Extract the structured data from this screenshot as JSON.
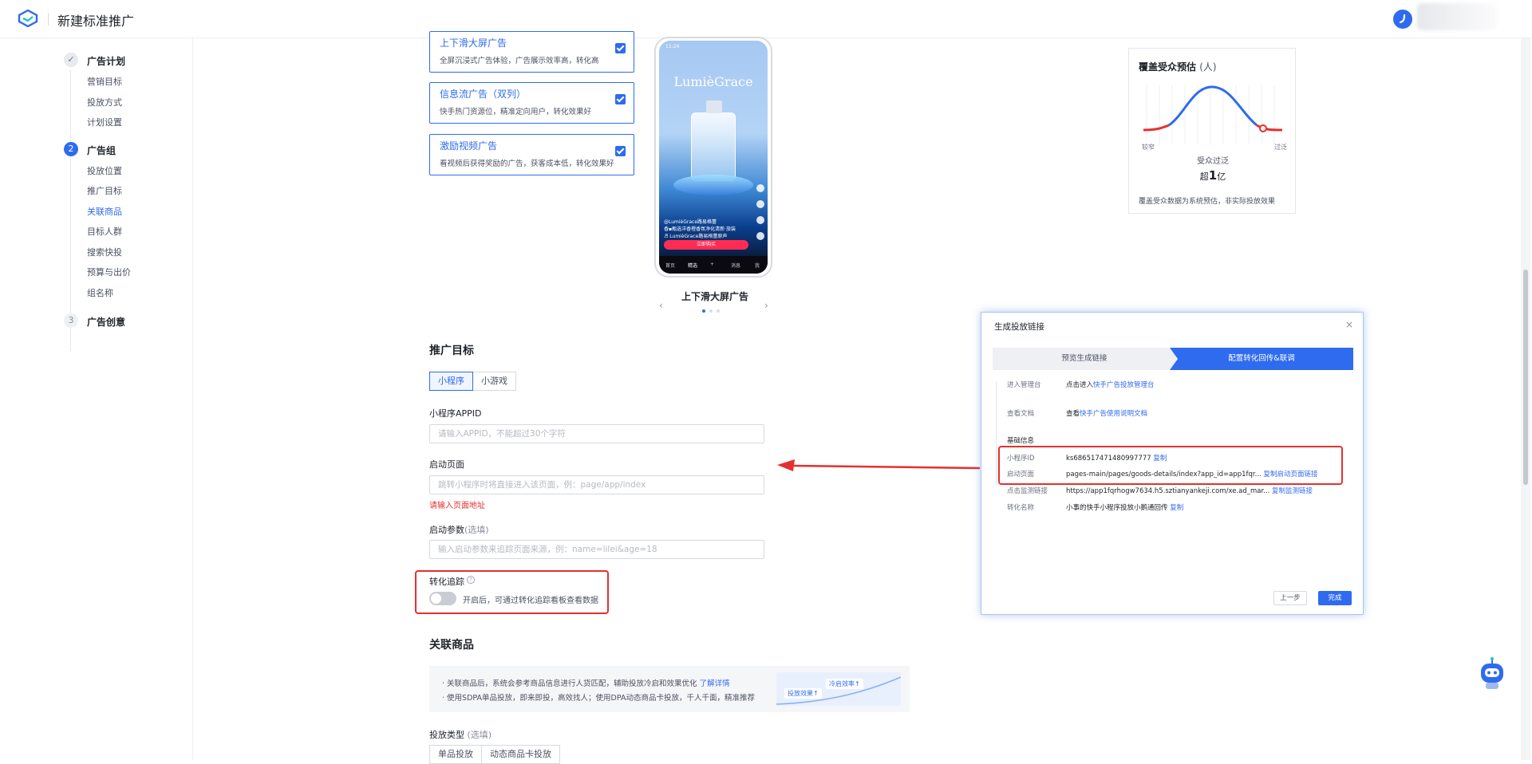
{
  "header": {
    "title": "新建标准推广"
  },
  "colors": {
    "primary": "#2f6bef",
    "danger": "#e5302f",
    "curve_red": "#e5302f",
    "curve_blue": "#2f6bef"
  },
  "sidebar": {
    "steps": [
      {
        "index": "✓",
        "label": "广告计划",
        "items": [
          "营销目标",
          "投放方式",
          "计划设置"
        ]
      },
      {
        "index": "2",
        "label": "广告组",
        "items": [
          "投放位置",
          "推广目标",
          "关联商品",
          "目标人群",
          "搜索快投",
          "预算与出价",
          "组名称"
        ],
        "active_item": "关联商品"
      },
      {
        "index": "3",
        "label": "广告创意",
        "items": []
      }
    ]
  },
  "placements": [
    {
      "title": "上下滑大屏广告",
      "desc": "全屏沉浸式广告体验，广告展示效率高，转化高"
    },
    {
      "title": "信息流广告（双列）",
      "desc": "快手热门资源位，精准定向用户，转化效果好"
    },
    {
      "title": "激励视频广告",
      "desc": "看视频后获得奖励的广告，获客成本低，转化效果好"
    }
  ],
  "preview": {
    "brand": "LumièGrace",
    "caption": "上下滑大屏广告",
    "time": "11:24",
    "account": "@LumièGrace路易格蕾",
    "line1": "香▪甄选洋香橙香氛净化清新·旅装",
    "line2": "♬ LumièGrace路易格蕾原声",
    "cta": "立即购买",
    "nav": [
      "首页",
      "精选",
      "+",
      "消息",
      "我"
    ]
  },
  "target": {
    "section_title": "推广目标",
    "tabs": [
      "小程序",
      "小游戏"
    ],
    "appid_label": "小程序APPID",
    "appid_placeholder": "请输入APPID，不能超过30个字符",
    "launch_label": "启动页面",
    "launch_placeholder": "跳转小程序时将直接进入该页面，例：page/app/index",
    "launch_error": "请输入页面地址",
    "params_label": "启动参数",
    "params_optional": "(选填)",
    "params_placeholder": "输入启动参数来追踪页面来源，例：name=lilei&age=18",
    "track_label": "转化追踪",
    "track_note": "开启后，可通过转化追踪看板查看数据"
  },
  "product": {
    "section_title": "关联商品",
    "line1": "· 关联商品后，系统会参考商品信息进行人货匹配，辅助投放冷启和效果优化",
    "line1_link": "了解详情",
    "line2": "· 使用SDPA单品投放，即来即投，高效找人；使用DPA动态商品卡投放，千人千面，精准推荐",
    "chart_tags": [
      "投放效果↑",
      "冷启效率↑"
    ],
    "type_label": "投放类型",
    "type_optional": "(选填)",
    "type_tabs": [
      "单品投放",
      "动态商品卡投放"
    ]
  },
  "audience": {
    "title": "覆盖受众预估",
    "unit": "(人)",
    "left_label": "较窄",
    "right_label": "过泛",
    "status": "受众过泛",
    "big_prefix": "超",
    "big_number": "1",
    "big_unit": "亿",
    "note": "覆盖受众数据为系统预估，非实际投放效果"
  },
  "modal": {
    "title": "生成投放链接",
    "close": "×",
    "step1": "预览生成链接",
    "step2": "配置转化回传&联调",
    "rows": [
      {
        "key": "进入管理台",
        "prefix": "点击进入",
        "link": "快手广告投放管理台"
      },
      {
        "key": "查看文档",
        "prefix": "查看",
        "link": "快手广告使用说明文档"
      }
    ],
    "basic_title": "基础信息",
    "info": [
      {
        "key": "小程序ID",
        "value": "ks686517471480997777",
        "link": "复制"
      },
      {
        "key": "启动页面",
        "value": "pages-main/pages/goods-details/index?app_id=app1fqr...",
        "link": "复制启动页面链接"
      },
      {
        "key": "点击监测链接",
        "value": "https://app1fqrhogw7634.h5.sztianyankeji.com/xe.ad_mar...",
        "link": "复制监测链接"
      },
      {
        "key": "转化名称",
        "value": "小事的快手小程序投放小鹅通回传",
        "link": "复制"
      }
    ],
    "prev": "上一步",
    "done": "完成"
  }
}
